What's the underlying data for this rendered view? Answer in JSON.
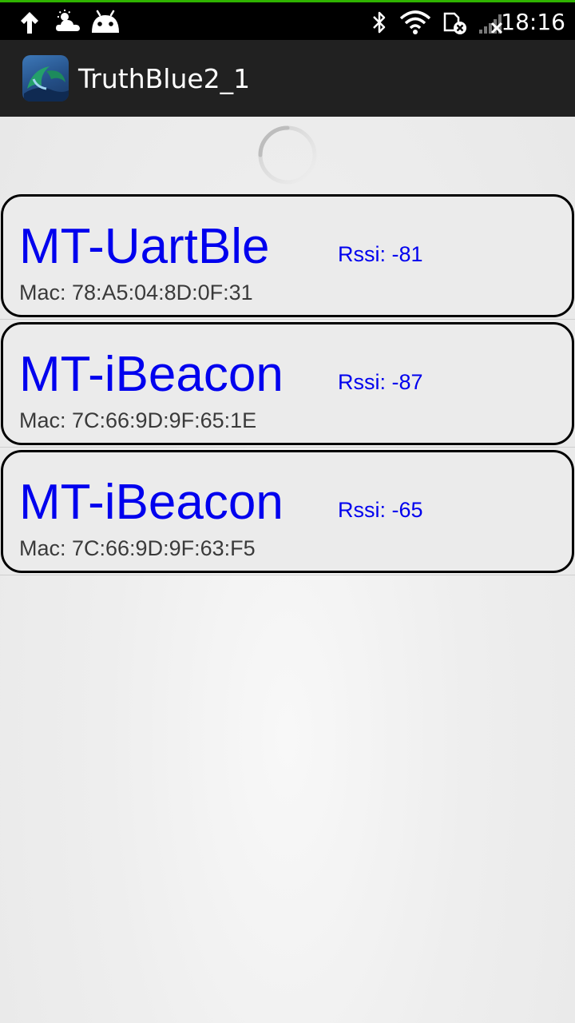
{
  "status_bar": {
    "time": "18:16",
    "accent_color": "#2fb300",
    "left_icons": [
      "upload-arrow-icon",
      "weather-cloud-sun-icon",
      "android-robot-icon"
    ],
    "right_icons": [
      "bluetooth-icon",
      "wifi-icon",
      "sim-error-icon",
      "cellular-signal-no-service-icon"
    ]
  },
  "action_bar": {
    "title": "TruthBlue2_1",
    "icon": "app-logo-icon"
  },
  "loading": {
    "icon": "progress-spinner-icon"
  },
  "devices": [
    {
      "name": "MT-UartBle",
      "rssi": "Rssi: -81",
      "mac": "Mac: 78:A5:04:8D:0F:31"
    },
    {
      "name": "MT-iBeacon",
      "rssi": "Rssi: -87",
      "mac": "Mac: 7C:66:9D:9F:65:1E"
    },
    {
      "name": "MT-iBeacon",
      "rssi": "Rssi: -65",
      "mac": "Mac: 7C:66:9D:9F:63:F5"
    }
  ],
  "colors": {
    "device_name": "#0000ee",
    "rssi": "#0000ee",
    "mac": "#3a3a3a",
    "card_border": "#000000",
    "action_bar_bg": "#212121"
  }
}
